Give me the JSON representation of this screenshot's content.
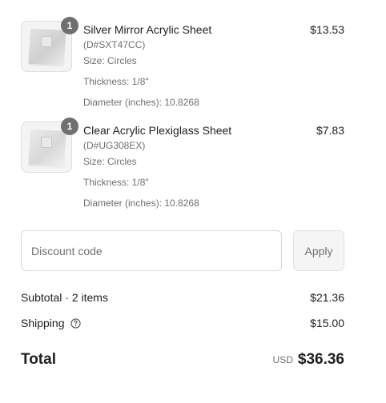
{
  "cart": {
    "items": [
      {
        "quantity": "1",
        "title": "Silver Mirror Acrylic Sheet",
        "sku": "(D#SXT47CC)",
        "size": "Size: Circles",
        "thickness": "Thickness: 1/8\"",
        "diameter": "Diameter (inches): 10.8268",
        "price": "$13.53",
        "thumbnail_icon": "silver-mirror-acrylic-thumbnail"
      },
      {
        "quantity": "1",
        "title": "Clear Acrylic Plexiglass Sheet",
        "sku": "(D#UG308EX)",
        "size": "Size: Circles",
        "thickness": "Thickness: 1/8\"",
        "diameter": "Diameter (inches): 10.8268",
        "price": "$7.83",
        "thumbnail_icon": "clear-acrylic-thumbnail"
      }
    ]
  },
  "discount": {
    "placeholder": "Discount code",
    "value": "",
    "apply_label": "Apply"
  },
  "summary": {
    "subtotal_label": "Subtotal · 2 items",
    "subtotal_value": "$21.36",
    "shipping_label": "Shipping",
    "shipping_help_icon": "question-circle-icon",
    "shipping_value": "$15.00",
    "total_label": "Total",
    "currency": "USD",
    "total_value": "$36.36"
  },
  "colors": {
    "text_primary": "#1f1f1f",
    "text_secondary": "#707070",
    "badge": "#707070",
    "border": "#d9d9d9"
  }
}
